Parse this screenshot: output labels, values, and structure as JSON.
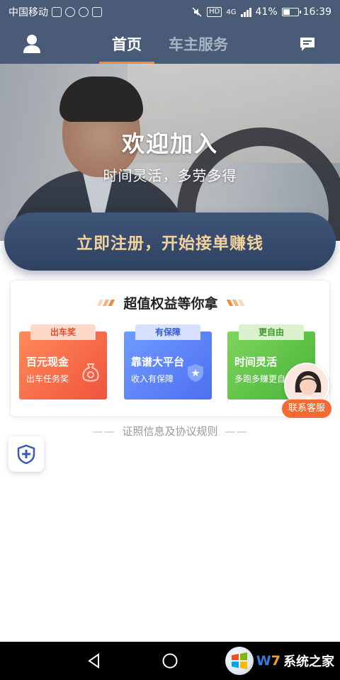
{
  "status_bar": {
    "carrier": "中国移动",
    "network": "4G",
    "battery_percent": "41%",
    "battery_level": 0.41,
    "time": "16:39",
    "hd_label": "HD"
  },
  "top_nav": {
    "tabs": [
      {
        "label": "首页",
        "active": true
      },
      {
        "label": "车主服务",
        "active": false
      }
    ]
  },
  "hero": {
    "title": "欢迎加入",
    "subtitle": "时间灵活，多劳多得"
  },
  "register_button": {
    "label": "立即注册，开始接单赚钱"
  },
  "benefits": {
    "title": "超值权益等你拿",
    "cards": [
      {
        "tag": "出车奖",
        "title": "百元现金",
        "desc": "出车任务奖"
      },
      {
        "tag": "有保障",
        "title": "靠谱大平台",
        "desc": "收入有保障"
      },
      {
        "tag": "更自由",
        "title": "时间灵活",
        "desc": "多跑多赚更自由"
      }
    ]
  },
  "customer_service": {
    "label": "联系客服"
  },
  "license_link": {
    "dash_left": "——",
    "label": "证照信息及协议规则",
    "dash_right": "——"
  },
  "watermark": {
    "text_w": "W",
    "text_7": "7",
    "text_rest": "系统之家"
  },
  "colors": {
    "nav_bg": "#4a5b78",
    "accent": "#f08b3c",
    "register_text": "#f2d19c",
    "register_bg": "#34496c"
  }
}
